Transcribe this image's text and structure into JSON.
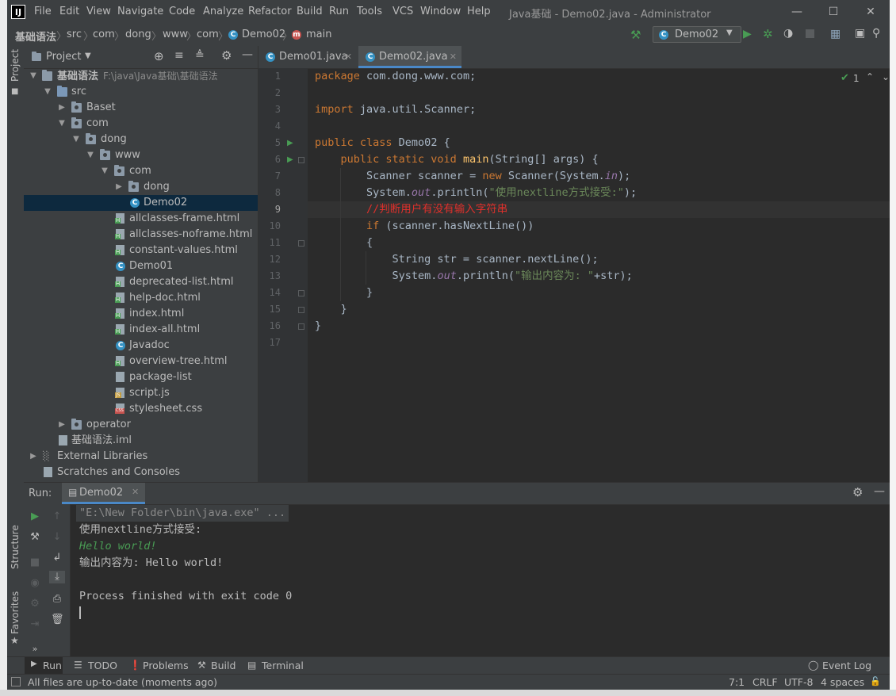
{
  "window": {
    "title": "Java基础 - Demo02.java - Administrator",
    "menu": [
      "File",
      "Edit",
      "View",
      "Navigate",
      "Code",
      "Analyze",
      "Refactor",
      "Build",
      "Run",
      "Tools",
      "VCS",
      "Window",
      "Help"
    ]
  },
  "breadcrumb": [
    "基础语法",
    "src",
    "com",
    "dong",
    "www",
    "com",
    "Demo02",
    "main"
  ],
  "run_config": {
    "selected": "Demo02"
  },
  "project_panel": {
    "title": "Project",
    "root_label": "基础语法",
    "root_path": "F:\\java\\Java基础\\基础语法",
    "items": [
      {
        "label": "src"
      },
      {
        "label": "Baset"
      },
      {
        "label": "com"
      },
      {
        "label": "dong"
      },
      {
        "label": "www"
      },
      {
        "label": "com"
      },
      {
        "label": "dong"
      },
      {
        "label": "Demo02"
      },
      {
        "label": "allclasses-frame.html"
      },
      {
        "label": "allclasses-noframe.html"
      },
      {
        "label": "constant-values.html"
      },
      {
        "label": "Demo01"
      },
      {
        "label": "deprecated-list.html"
      },
      {
        "label": "help-doc.html"
      },
      {
        "label": "index.html"
      },
      {
        "label": "index-all.html"
      },
      {
        "label": "Javadoc"
      },
      {
        "label": "overview-tree.html"
      },
      {
        "label": "package-list"
      },
      {
        "label": "script.js"
      },
      {
        "label": "stylesheet.css"
      },
      {
        "label": "operator"
      },
      {
        "label": "基础语法.iml"
      },
      {
        "label": "External Libraries"
      },
      {
        "label": "Scratches and Consoles"
      }
    ]
  },
  "editor": {
    "tabs": [
      {
        "label": "Demo01.java"
      },
      {
        "label": "Demo02.java"
      }
    ],
    "inspection_count": "1",
    "lines": [
      "1",
      "2",
      "3",
      "4",
      "5",
      "6",
      "7",
      "8",
      "9",
      "10",
      "11",
      "12",
      "13",
      "14",
      "15",
      "16",
      "17"
    ],
    "code": {
      "l1_kw": "package",
      "l1_rest": " com.dong.www.com;",
      "l3_kw": "import",
      "l3_rest": " java.util.Scanner;",
      "l5_kw": "public class",
      "l5_rest": " Demo02 {",
      "l6_kw": "    public static void",
      "l6_fn": " main",
      "l6_rest": "(String[] args) {",
      "l7_a": "        Scanner scanner = ",
      "l7_kw": "new",
      "l7_b": " Scanner(System.",
      "l7_it": "in",
      "l7_c": ");",
      "l8_a": "        System.",
      "l8_it": "out",
      "l8_b": ".println(",
      "l8_str": "\"使用nextline方式接受:\"",
      "l8_c": ");",
      "l9_cm": "        //判断用户有没有输入字符串",
      "l10_kw": "        if",
      "l10_rest": " (scanner.hasNextLine())",
      "l11": "        {",
      "l12": "            String str = scanner.nextLine();",
      "l13_a": "            System.",
      "l13_it": "out",
      "l13_b": ".println(",
      "l13_str": "\"输出内容为: \"",
      "l13_c": "+str);",
      "l14": "        }",
      "l15": "    }",
      "l16": "}"
    }
  },
  "run_panel": {
    "label": "Run:",
    "tab": "Demo02",
    "console": [
      "\"E:\\New Folder\\bin\\java.exe\" ...",
      "使用nextline方式接受:",
      "Hello world!",
      "输出内容为: Hello world!",
      "",
      "Process finished with exit code 0"
    ]
  },
  "bottom_tools": {
    "run": "Run",
    "todo": "TODO",
    "problems": "Problems",
    "build": "Build",
    "terminal": "Terminal",
    "event_log": "Event Log"
  },
  "side_labels": {
    "project": "Project",
    "structure": "Structure",
    "favorites": "Favorites"
  },
  "status": {
    "message": "All files are up-to-date (moments ago)",
    "position": "7:1",
    "line_sep": "CRLF",
    "encoding": "UTF-8",
    "indent": "4 spaces"
  },
  "colors": {
    "keyword": "#cc7832",
    "string": "#6a8759",
    "comment": "#e0302b",
    "function": "#ffc66d",
    "accent": "#4a88c7",
    "run_green": "#499c54"
  }
}
